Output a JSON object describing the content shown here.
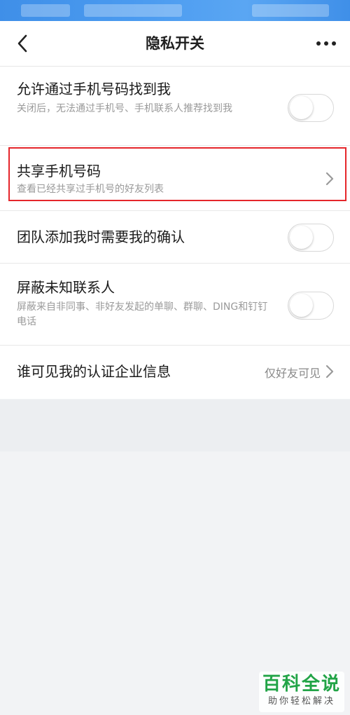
{
  "header": {
    "title": "隐私开关",
    "back_icon": "chevron-left-icon",
    "more_icon": "more-dots-icon"
  },
  "settings": [
    {
      "title": "允许通过手机号码找到我",
      "subtitle": "关闭后，无法通过手机号、手机联系人推荐找到我",
      "control": "toggle",
      "enabled": false
    },
    {
      "title": "共享手机号码",
      "subtitle": "查看已经共享过手机号的好友列表",
      "control": "chevron",
      "highlighted": true
    },
    {
      "title": "团队添加我时需要我的确认",
      "control": "toggle",
      "enabled": false
    },
    {
      "title": "屏蔽未知联系人",
      "subtitle": "屏蔽来自非同事、非好友发起的单聊、群聊、DING和钉钉电话",
      "control": "toggle",
      "enabled": false
    },
    {
      "title": "谁可见我的认证企业信息",
      "value": "仅好友可见",
      "control": "chevron"
    }
  ],
  "watermark": {
    "main": "百科全说",
    "sub": "助你轻松解决"
  },
  "colors": {
    "status_bar": "#4b9bf0",
    "highlight_border": "#e5262b",
    "watermark_green": "#22a447"
  }
}
